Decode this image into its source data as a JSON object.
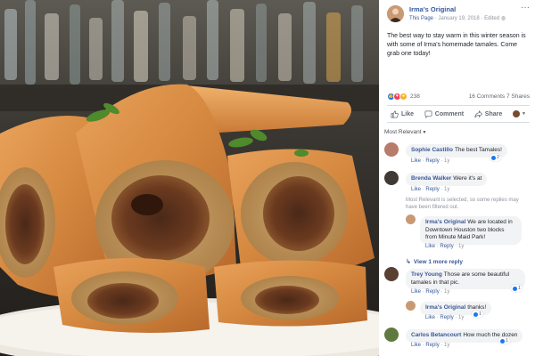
{
  "post": {
    "page_name": "Irma's Original",
    "meta_link": "This Page",
    "date": "January 19, 2018",
    "edited": "Edited",
    "menu_icon": "more-dots-icon",
    "text": "The best way to stay warm in this winter season is with some of Irma's homemade tamales. Come grab one today!"
  },
  "stats": {
    "reaction_count": "238",
    "comments": "16 Comments",
    "shares": "7 Shares"
  },
  "actions": {
    "like": "Like",
    "comment": "Comment",
    "share": "Share"
  },
  "sort": {
    "label": "Most Relevant",
    "filter_note": "Most Relevant is selected, so some replies may have been filtered out."
  },
  "comments": [
    {
      "author": "Sophie Castillo",
      "text": "The best Tamales!",
      "like": "Like",
      "reply": "Reply",
      "time": "1y",
      "reactions": "2"
    },
    {
      "author": "Brenda Walker",
      "text": "Were it's at",
      "like": "Like",
      "reply": "Reply",
      "time": "1y"
    },
    {
      "author": "Irma's Original",
      "text": "We are located in Downtown Houston two blocks from Minute Maid Park!",
      "like": "Like",
      "reply": "Reply",
      "time": "1y"
    },
    {
      "more_replies": "View 1 more reply"
    },
    {
      "author": "Trey Young",
      "text": "Those are some beautiful tamales in that pic.",
      "like": "Like",
      "reply": "Reply",
      "time": "1y",
      "reactions": "1"
    },
    {
      "author": "Irma's Original",
      "text": "thanks!",
      "like": "Like",
      "reply": "Reply",
      "time": "1y",
      "reactions": "1"
    },
    {
      "author": "Carlos Betancourt",
      "text": "How much the dozen",
      "like": "Like",
      "reply": "Reply",
      "time": "1y",
      "reactions": "1"
    }
  ],
  "colors": {
    "link_blue": "#365899",
    "like_blue": "#1877f2",
    "bubble_gray": "#f2f3f5",
    "meta_gray": "#90949c"
  }
}
